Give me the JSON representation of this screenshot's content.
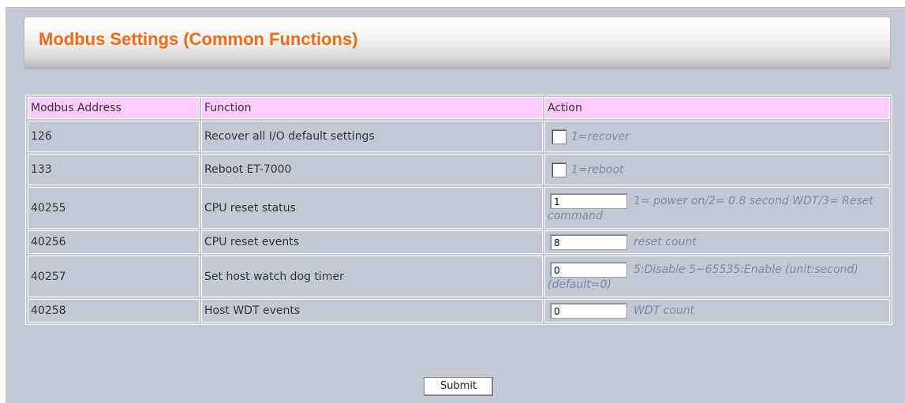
{
  "page": {
    "title": "Modbus Settings (Common Functions)"
  },
  "table": {
    "headers": [
      "Modbus Address",
      "Function",
      "Action"
    ],
    "rows": [
      {
        "address": "126",
        "function": "Recover all I/O default settings",
        "hint": "1=recover"
      },
      {
        "address": "133",
        "function": "Reboot ET-7000",
        "hint": "1=reboot"
      },
      {
        "address": "40255",
        "function": "CPU reset status",
        "value": "1",
        "hint": "1= power on/2= 0.8 second WDT/3= Reset command"
      },
      {
        "address": "40256",
        "function": "CPU reset events",
        "value": "8",
        "hint": "reset count"
      },
      {
        "address": "40257",
        "function": "Set host watch dog timer",
        "value": "0",
        "hint": "5:Disable 5~65535:Enable (unit:second) (default=0)"
      },
      {
        "address": "40258",
        "function": "Host WDT events",
        "value": "0",
        "hint": "WDT count"
      }
    ]
  },
  "submit_label": "Submit"
}
